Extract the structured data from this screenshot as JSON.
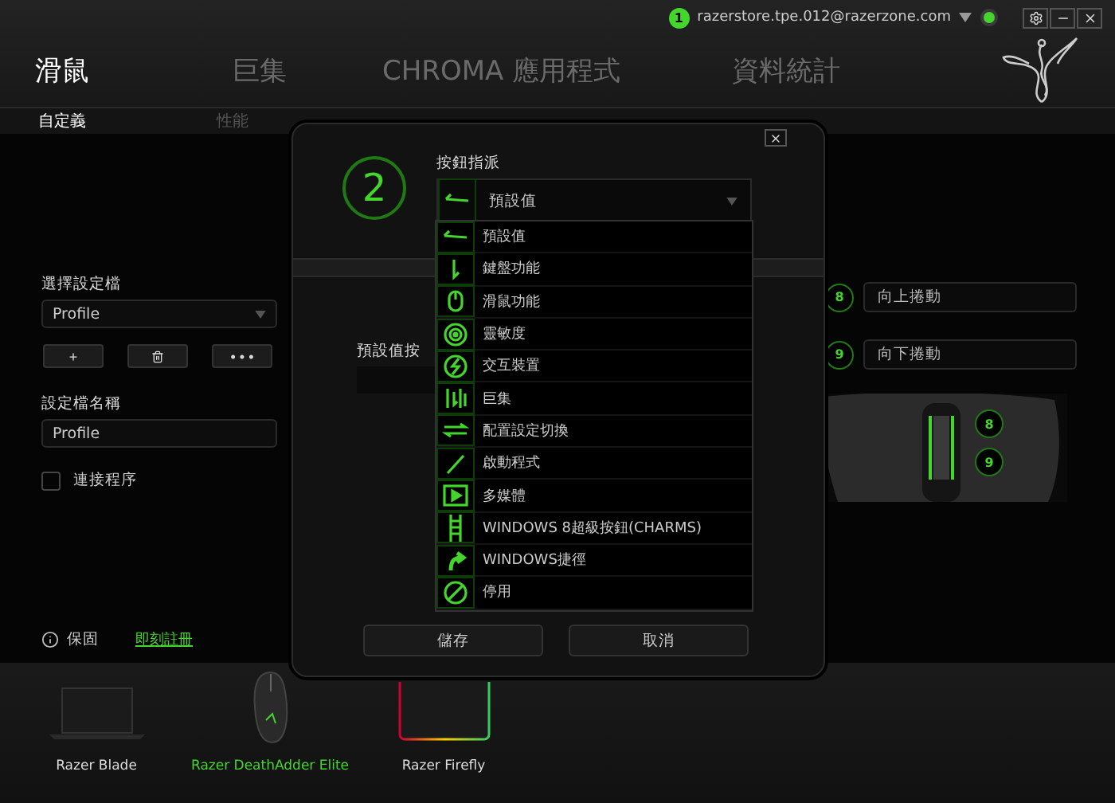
{
  "account": {
    "notification_count": "1",
    "email": "razerstore.tpe.012@razerzone.com"
  },
  "nav_tabs": [
    {
      "label": "滑鼠",
      "selected": true
    },
    {
      "label": "巨集",
      "selected": false
    },
    {
      "label": "CHROMA 應用程式",
      "selected": false
    },
    {
      "label": "資料統計",
      "selected": false
    }
  ],
  "sub_tabs": [
    {
      "label": "自定義",
      "selected": true
    },
    {
      "label": "性能",
      "selected": false
    }
  ],
  "profile_panel": {
    "profile_label": "選擇設定檔",
    "profile_value": "Profile",
    "profile_buttons": [
      {
        "kind": "text",
        "label": "+"
      },
      {
        "kind": "delete"
      },
      {
        "kind": "text",
        "label": "• • •"
      }
    ],
    "name_label": "設定檔名稱",
    "name_value": "Profile",
    "link_program": {
      "label": "連接程序",
      "checked": false
    },
    "warranty": "保固",
    "register_link": "即刻註冊"
  },
  "key_field": {
    "label": "預設值按"
  },
  "scroll_bindings": [
    {
      "number": "8",
      "action": "向上捲動"
    },
    {
      "number": "9",
      "action": "向下捲動"
    }
  ],
  "mouse_view": {
    "badges": [
      "8",
      "9"
    ]
  },
  "devices": [
    {
      "name": "Razer Blade",
      "kind": "laptop",
      "selected": false
    },
    {
      "name": "Razer DeathAdder Elite",
      "kind": "mouse",
      "selected": true
    },
    {
      "name": "Razer Firefly",
      "kind": "mousepad",
      "selected": false
    }
  ],
  "dialog": {
    "button_number": "2",
    "assign_label": "按鈕指派",
    "selection": {
      "kind": "default",
      "label": "預設值"
    },
    "options": [
      {
        "label": "預設值",
        "kind": "default"
      },
      {
        "label": "鍵盤功能",
        "kind": "keyboard"
      },
      {
        "label": "滑鼠功能",
        "kind": "mouse"
      },
      {
        "label": "靈敏度",
        "kind": "sensitivity"
      },
      {
        "label": "交互裝置",
        "kind": "interdevice"
      },
      {
        "label": "巨集",
        "kind": "macro"
      },
      {
        "label": "配置設定切換",
        "kind": "profile_switch"
      },
      {
        "label": "啟動程式",
        "kind": "launch"
      },
      {
        "label": "多媒體",
        "kind": "multimedia"
      },
      {
        "label": "WINDOWS 8超級按鈕(CHARMS)",
        "kind": "charms"
      },
      {
        "label": "WINDOWS捷徑",
        "kind": "shortcut"
      },
      {
        "label": "停用",
        "kind": "disable"
      }
    ],
    "buttons": [
      "儲存",
      "取消"
    ]
  }
}
